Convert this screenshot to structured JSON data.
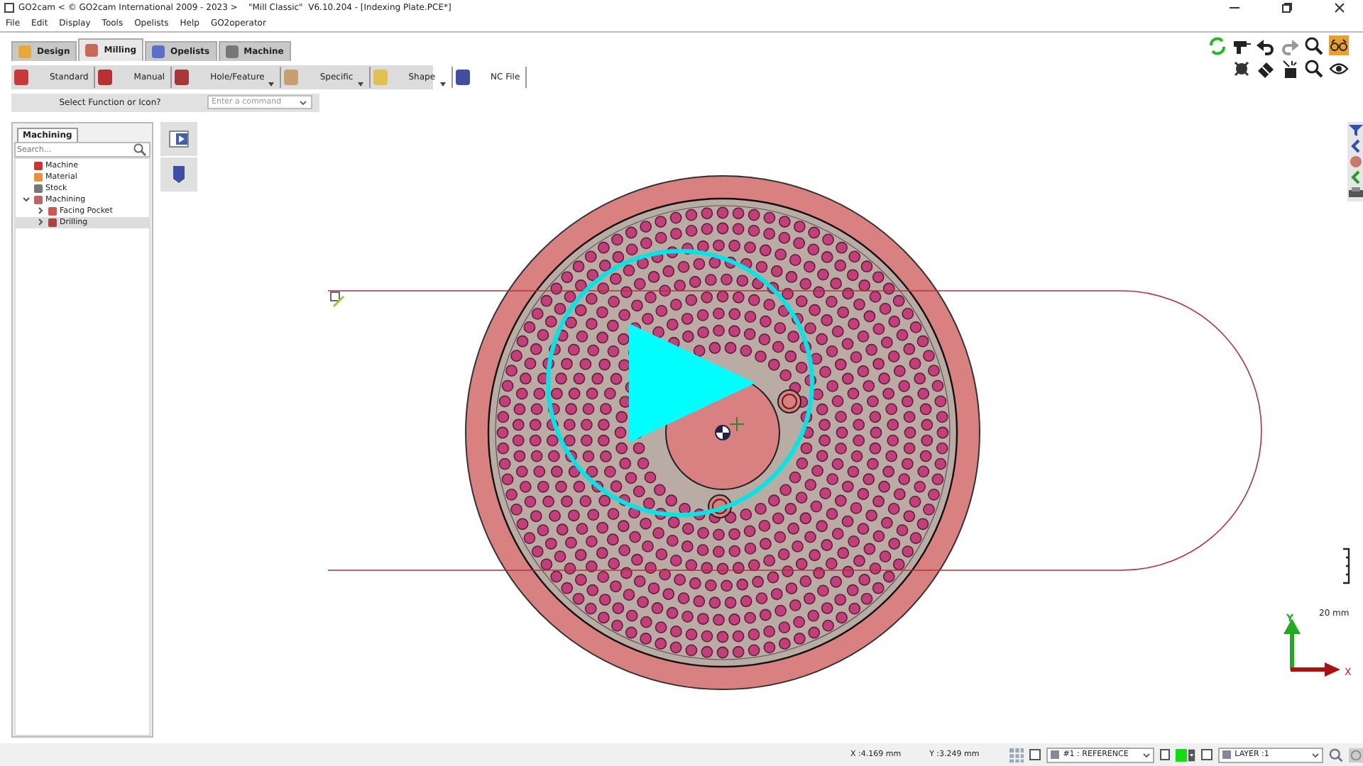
{
  "window": {
    "title": "GO2cam < © GO2cam International 2009 - 2023 >    \"Mill Classic\"  V6.10.204 - [Indexing Plate.PCE*]"
  },
  "menu": [
    "File",
    "Edit",
    "Display",
    "Tools",
    "Opelists",
    "Help",
    "GO2operator"
  ],
  "tabs": [
    {
      "label": "Design",
      "selected": false
    },
    {
      "label": "Milling",
      "selected": true
    },
    {
      "label": "Opelists",
      "selected": false
    },
    {
      "label": "Machine",
      "selected": false
    }
  ],
  "toolbar": [
    {
      "label": "Standard",
      "dropdown": false
    },
    {
      "label": "Manual",
      "dropdown": false
    },
    {
      "label": "Hole/Feature",
      "dropdown": true
    },
    {
      "label": "Specific",
      "dropdown": true
    },
    {
      "label": "Shape",
      "dropdown": true
    },
    {
      "label": "NC File",
      "dropdown": false
    }
  ],
  "command_bar": {
    "label": "Select Function or Icon?",
    "placeholder": "Enter a command"
  },
  "panel": {
    "tab": "Machining",
    "search_placeholder": "Search...",
    "tree": [
      {
        "label": "Machine",
        "selected": false
      },
      {
        "label": "Material",
        "selected": false
      },
      {
        "label": "Stock",
        "selected": false
      },
      {
        "label": "Machining",
        "selected": false,
        "expanded": true,
        "children": [
          {
            "label": "Facing Pocket",
            "selected": false,
            "expanded": false
          },
          {
            "label": "Drilling",
            "selected": true,
            "expanded": false
          }
        ]
      }
    ]
  },
  "viewport": {
    "scale_label": "20 mm",
    "axis_y": "Y",
    "axis_x": "X"
  },
  "status_bar": {
    "x": "X :4.169 mm",
    "y": "Y :3.249 mm",
    "reference": "#1 : REFERENCE",
    "layer": "LAYER :1",
    "checkboxes": [
      {
        "checked": false
      },
      {
        "checked": false
      },
      {
        "checked": false
      }
    ]
  }
}
